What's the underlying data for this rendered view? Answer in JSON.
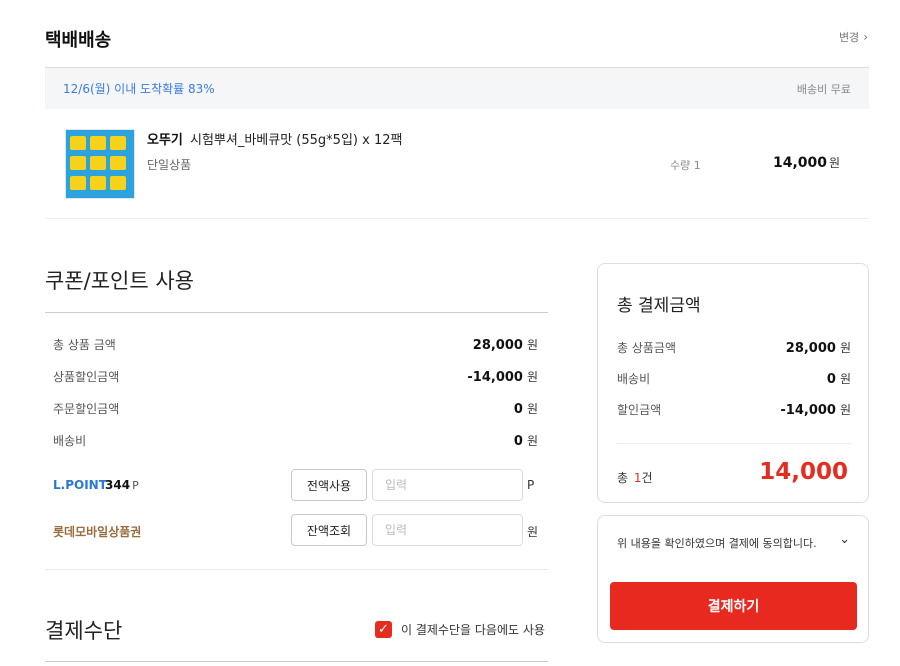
{
  "shipping": {
    "title": "택배배송",
    "change_label": "변경",
    "eta": "12/6(월) 이내 도착확률 83%",
    "fee": "배송비 무료"
  },
  "product": {
    "brand": "오뚜기",
    "name": "시험뿌셔_바베큐맛 (55g*5입) x 12팩",
    "type": "단일상품",
    "quantity": "수량 1",
    "price": "14,000",
    "currency": "원"
  },
  "coupon": {
    "title": "쿠폰/포인트 사용",
    "rows": [
      {
        "label": "총 상품 금액",
        "value": "28,000",
        "unit": "원"
      },
      {
        "label": "상품할인금액",
        "value": "-14,000",
        "unit": "원"
      },
      {
        "label": "주문할인금액",
        "value": "0",
        "unit": "원"
      },
      {
        "label": "배송비",
        "value": "0",
        "unit": "원"
      }
    ],
    "lpoint": {
      "label": "L.POINT",
      "value": "344",
      "unit": "P",
      "button": "전액사용",
      "placeholder": "입력",
      "input_unit": "P"
    },
    "giftcard": {
      "label": "롯데모바일상품권",
      "button": "잔액조회",
      "placeholder": "입력",
      "input_unit": "원"
    }
  },
  "payment": {
    "title": "결제수단",
    "reuse_label": "이 결제수단을 다음에도 사용"
  },
  "total": {
    "title": "총 결제금액",
    "rows": [
      {
        "label": "총 상품금액",
        "value": "28,000",
        "unit": "원"
      },
      {
        "label": "배송비",
        "value": "0",
        "unit": "원"
      },
      {
        "label": "할인금액",
        "value": "-14,000",
        "unit": "원"
      }
    ],
    "count_prefix": "총",
    "count": "1",
    "count_suffix": "건",
    "amount": "14,000"
  },
  "agree": {
    "text": "위 내용을 확인하였으며 결제에 동의합니다.",
    "pay_button": "결제하기"
  },
  "colors": {
    "accent": "#e8291f",
    "link_blue": "#3c7ddb",
    "lpoint_blue": "#2a78d4",
    "giftcard_brown": "#9a6b3f"
  }
}
